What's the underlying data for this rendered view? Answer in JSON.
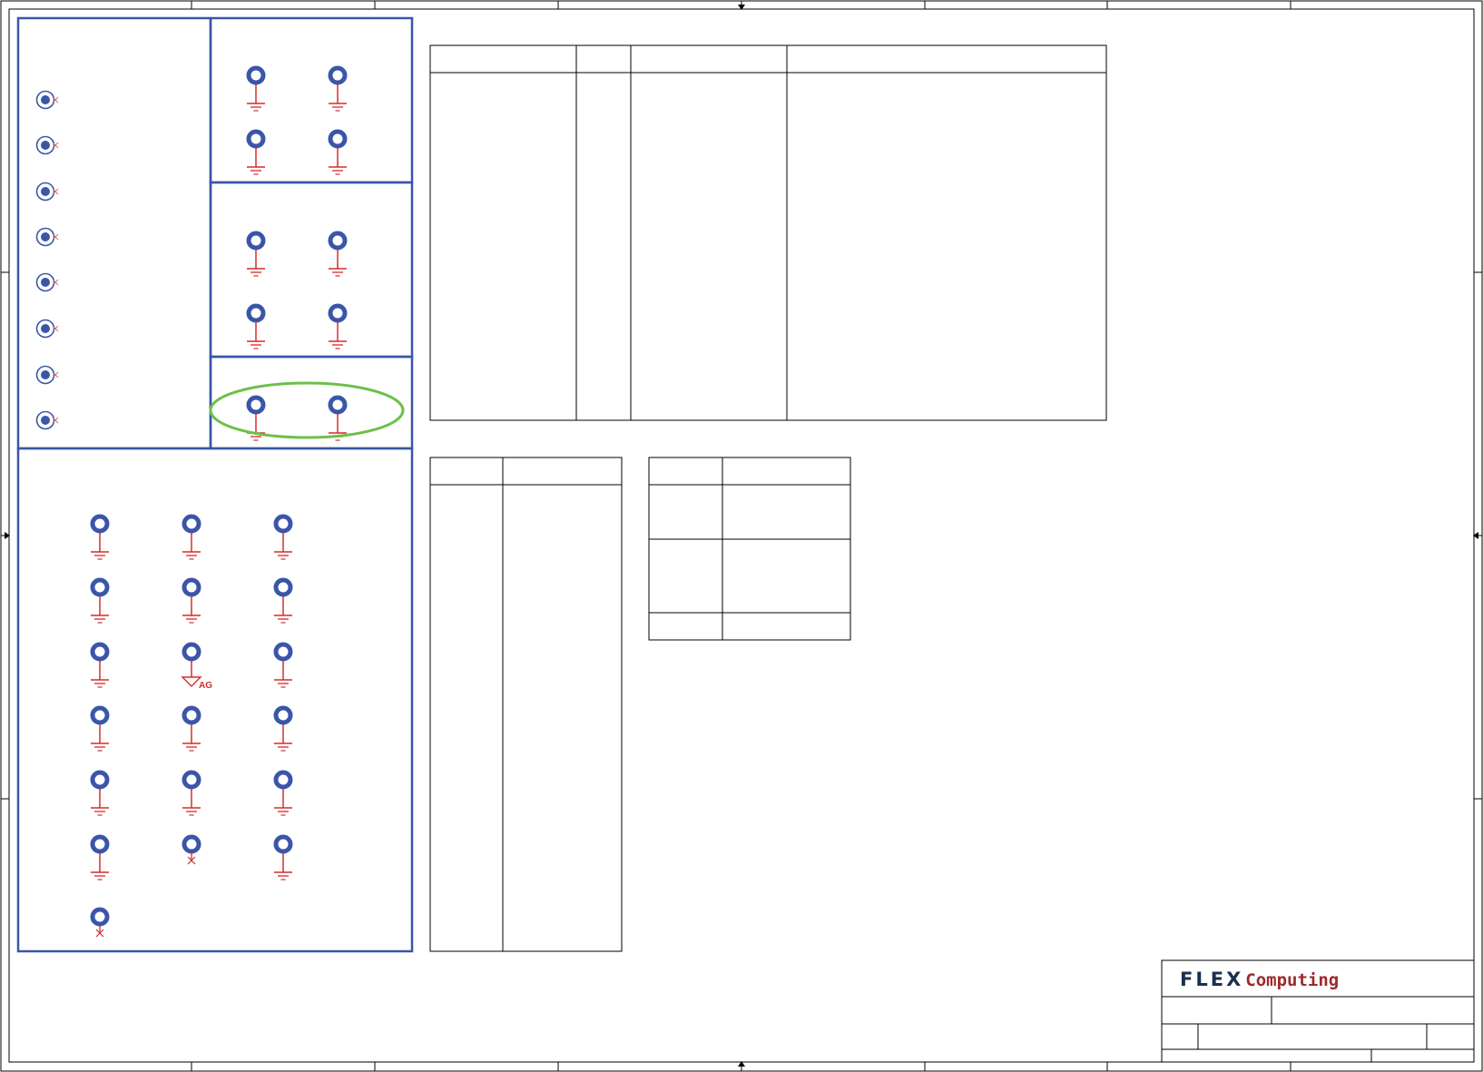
{
  "title_block": {
    "logo_primary": "FLEX",
    "logo_secondary": "Computing"
  },
  "symbols": {
    "analog_ground_label": "AG"
  },
  "colors": {
    "frame": "#000000",
    "group_border": "#3a56a8",
    "pad_fill": "#3a56a8",
    "net_red": "#d92a2a",
    "highlight": "#6cc04a",
    "logo_dark": "#1b2f4e",
    "logo_red": "#9e2a2b"
  }
}
